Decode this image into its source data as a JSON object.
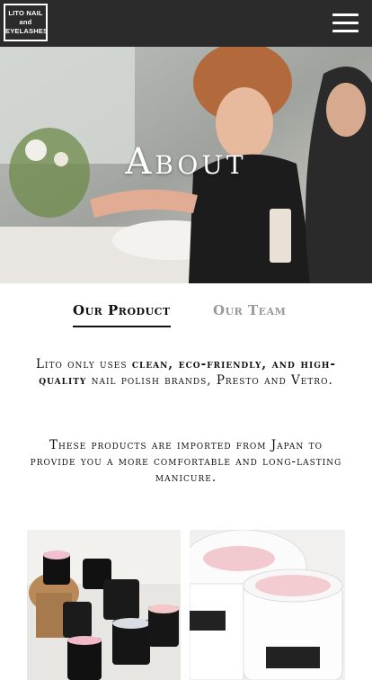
{
  "header": {
    "logo_line1": "LITO NAIL",
    "logo_line2": "and",
    "logo_line3": "EYELASHES",
    "menu_icon": "hamburger-menu-icon"
  },
  "hero": {
    "title": "About"
  },
  "tabs": [
    {
      "label": "Our Product",
      "active": true
    },
    {
      "label": "Our Team",
      "active": false
    }
  ],
  "content": {
    "p1_a": "Lito only uses ",
    "p1_b": "clean, eco-friendly, and high-quality",
    "p1_c": " nail polish brands, Presto and Vetro.",
    "p2": "These products are imported from Japan to provide you a more comfortable and long-lasting manicure."
  },
  "colors": {
    "header_bg": "#2b2b2b",
    "inactive_tab": "#999999"
  }
}
